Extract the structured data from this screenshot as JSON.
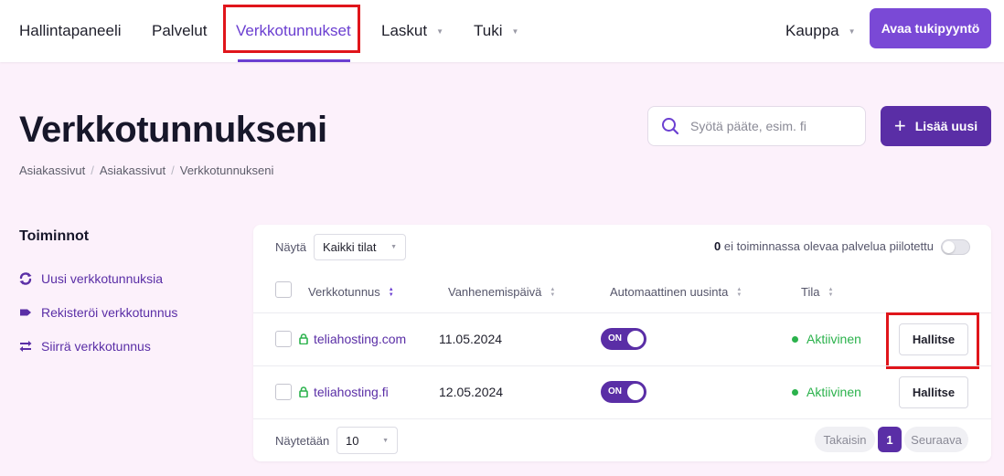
{
  "nav": {
    "items": [
      {
        "label": "Hallintapaneeli",
        "has_caret": false
      },
      {
        "label": "Palvelut",
        "has_caret": false
      },
      {
        "label": "Verkkotunnukset",
        "has_caret": false,
        "active": true
      },
      {
        "label": "Laskut",
        "has_caret": true
      },
      {
        "label": "Tuki",
        "has_caret": true
      }
    ],
    "shop_label": "Kauppa",
    "support_button": "Avaa tukipyyntö"
  },
  "header": {
    "title": "Verkkotunnukseni",
    "breadcrumb": [
      "Asiakassivut",
      "Asiakassivut",
      "Verkkotunnukseni"
    ],
    "search_placeholder": "Syötä pääte, esim. fi",
    "add_button": "Lisää uusi"
  },
  "sidebar": {
    "title": "Toiminnot",
    "items": [
      {
        "label": "Uusi verkkotunnuksia",
        "icon": "renew-icon"
      },
      {
        "label": "Rekisteröi verkkotunnus",
        "icon": "tag-icon"
      },
      {
        "label": "Siirrä verkkotunnus",
        "icon": "transfer-icon"
      }
    ]
  },
  "table": {
    "show_label": "Näytä",
    "filter_value": "Kaikki tilat",
    "hidden_count": "0",
    "hidden_text": "ei toiminnassa olevaa palvelua piilotettu",
    "columns": [
      "Verkkotunnus",
      "Vanhenemispäivä",
      "Automaattinen uusinta",
      "Tila"
    ],
    "rows": [
      {
        "domain": "teliahosting.com",
        "expiry": "11.05.2024",
        "auto_renew": "ON",
        "status": "Aktiivinen",
        "action": "Hallitse"
      },
      {
        "domain": "teliahosting.fi",
        "expiry": "12.05.2024",
        "auto_renew": "ON",
        "status": "Aktiivinen",
        "action": "Hallitse"
      }
    ],
    "per_page_label": "Näytetään",
    "per_page_value": "10",
    "pager": {
      "prev": "Takaisin",
      "current": "1",
      "next": "Seuraava"
    }
  },
  "colors": {
    "accent": "#6b3fd1",
    "accent_dark": "#5a2ea6",
    "status_active": "#2bb24c",
    "highlight": "#e0151b",
    "background": "#fcf1fb"
  }
}
